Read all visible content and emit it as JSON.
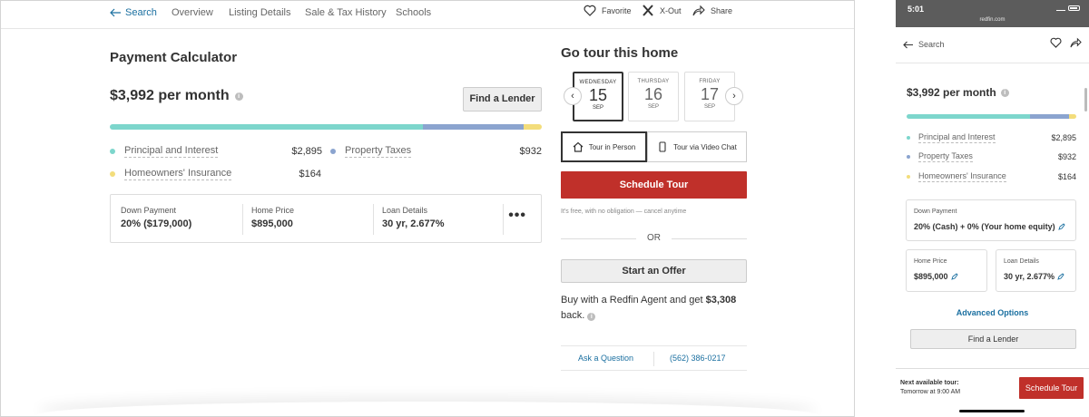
{
  "colors": {
    "principal": "#7dd6cc",
    "taxes": "#8ba4cf",
    "insurance": "#f3dd7b",
    "accent_red": "#c0302a",
    "link_blue": "#1a6fa0"
  },
  "desktop": {
    "nav": {
      "back_label": "Search",
      "tabs": [
        "Overview",
        "Listing Details",
        "Sale & Tax History",
        "Schools"
      ],
      "favorite": "Favorite",
      "xout": "X-Out",
      "share": "Share"
    },
    "calculator": {
      "title": "Payment Calculator",
      "monthly": "$3,992 per month",
      "find_lender": "Find a Lender",
      "breakdown": [
        {
          "label": "Principal and Interest",
          "value": "$2,895",
          "amount": 2895
        },
        {
          "label": "Property Taxes",
          "value": "$932",
          "amount": 932
        },
        {
          "label": "Homeowners' Insurance",
          "value": "$164",
          "amount": 164
        }
      ],
      "loan": {
        "down_payment_label": "Down Payment",
        "down_payment_value": "20% ($179,000)",
        "home_price_label": "Home Price",
        "home_price_value": "$895,000",
        "loan_details_label": "Loan Details",
        "loan_details_value": "30 yr, 2.677%",
        "more": "•••"
      }
    },
    "tour": {
      "title": "Go tour this home",
      "days": [
        {
          "weekday": "WEDNESDAY",
          "day": "15",
          "month": "SEP",
          "selected": true
        },
        {
          "weekday": "THURSDAY",
          "day": "16",
          "month": "SEP",
          "selected": false
        },
        {
          "weekday": "FRIDAY",
          "day": "17",
          "month": "SEP",
          "selected": false
        }
      ],
      "prev": "‹",
      "next": "›",
      "in_person": "Tour in Person",
      "video_chat": "Tour via Video Chat",
      "schedule": "Schedule Tour",
      "free_note": "It's free, with no obligation — cancel anytime",
      "or": "OR",
      "offer": "Start an Offer",
      "agent_text_pre": "Buy with a Redfin Agent and get ",
      "agent_amount": "$3,308",
      "agent_text_post": " back.",
      "ask": "Ask a Question",
      "phone": "(562) 386-0217"
    }
  },
  "mobile": {
    "status": {
      "time": "5:01",
      "url": "redfin.com"
    },
    "back_label": "Search",
    "monthly": "$3,992 per month",
    "breakdown": [
      {
        "label": "Principal and Interest",
        "value": "$2,895"
      },
      {
        "label": "Property Taxes",
        "value": "$932"
      },
      {
        "label": "Homeowners' Insurance",
        "value": "$164"
      }
    ],
    "down_payment_label": "Down Payment",
    "down_payment_value": "20% (Cash) + 0% (Your home equity)",
    "home_price_label": "Home Price",
    "home_price_value": "$895,000",
    "loan_details_label": "Loan Details",
    "loan_details_value": "30 yr, 2.677%",
    "advanced": "Advanced Options",
    "find_lender": "Find a Lender",
    "next_tour_label": "Next available tour:",
    "next_tour_time": "Tomorrow at 9:00 AM",
    "schedule": "Schedule Tour"
  }
}
